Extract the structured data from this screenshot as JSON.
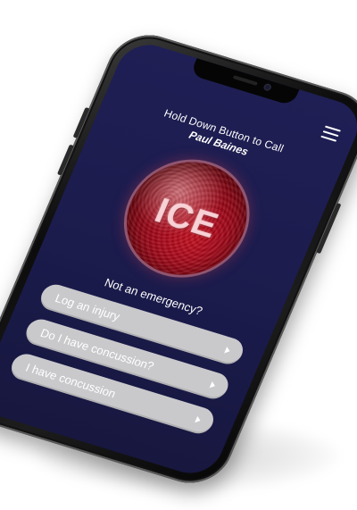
{
  "header": {
    "menu_icon": "hamburger-menu-icon"
  },
  "call": {
    "instruction": "Hold Down Button to Call",
    "contact_name": "Paul Baines"
  },
  "ice_button": {
    "label": "ICE",
    "color": "#a3081a"
  },
  "options": {
    "heading": "Not an emergency?",
    "items": [
      {
        "label": "Log an injury",
        "icon": "chevron-right-icon"
      },
      {
        "label": "Do I have concussion?",
        "icon": "chevron-right-icon"
      },
      {
        "label": "I have concussion",
        "icon": "chevron-right-icon"
      }
    ]
  },
  "theme": {
    "screen_background": "#1f1f55",
    "button_background": "#c9c9cc"
  }
}
